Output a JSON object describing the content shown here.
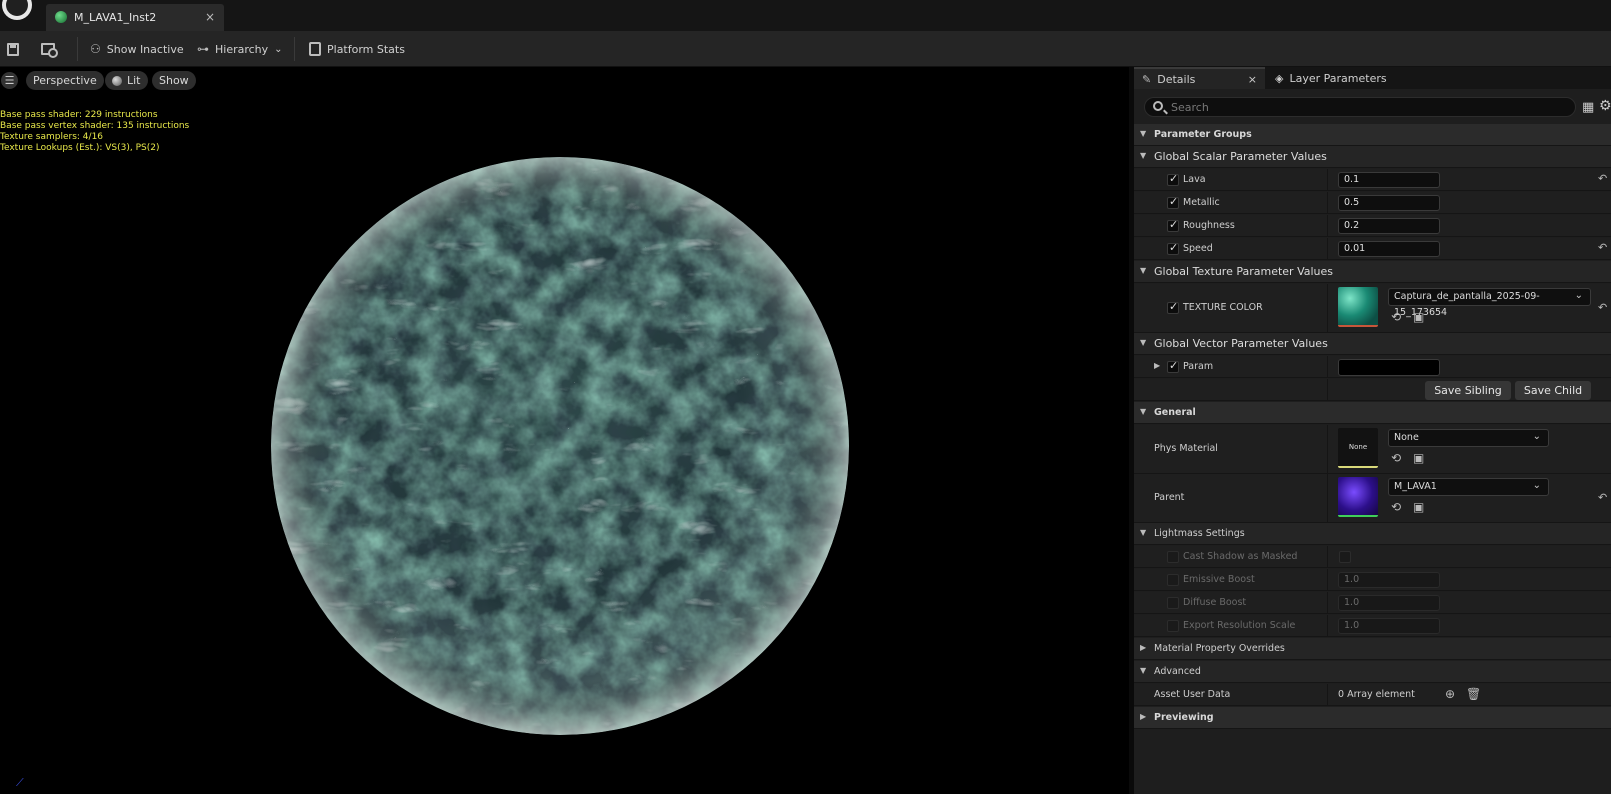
{
  "tab": {
    "title": "M_LAVA1_Inst2",
    "close": "×"
  },
  "toolbar": {
    "show_inactive": "Show Inactive",
    "hierarchy": "Hierarchy",
    "platform_stats": "Platform Stats"
  },
  "viewport": {
    "menu": "☰",
    "perspective": "Perspective",
    "lit": "Lit",
    "show": "Show",
    "stats": [
      "Base pass shader: 229 instructions",
      "Base pass vertex shader: 135 instructions",
      "Texture samplers: 4/16",
      "Texture Lookups (Est.): VS(3), PS(2)"
    ]
  },
  "panel": {
    "tabs": {
      "details": "Details",
      "layer_parameters": "Layer Parameters",
      "close": "×"
    },
    "search_placeholder": "Search",
    "parameter_groups": "Parameter Groups",
    "scalar": {
      "title": "Global Scalar Parameter Values",
      "items": [
        {
          "name": "Lava",
          "value": "0.1"
        },
        {
          "name": "Metallic",
          "value": "0.5"
        },
        {
          "name": "Roughness",
          "value": "0.2"
        },
        {
          "name": "Speed",
          "value": "0.01"
        }
      ]
    },
    "texture": {
      "title": "Global Texture Parameter Values",
      "name": "TEXTURE COLOR",
      "asset": "Captura_de_pantalla_2025-09-15_173654"
    },
    "vector": {
      "title": "Global Vector Parameter Values",
      "name": "Param"
    },
    "buttons": {
      "save_sibling": "Save Sibling",
      "save_child": "Save Child"
    },
    "general": {
      "title": "General",
      "phys_material_label": "Phys Material",
      "phys_material_thumb": "None",
      "phys_material_value": "None",
      "parent_label": "Parent",
      "parent_value": "M_LAVA1"
    },
    "lightmass": {
      "title": "Lightmass Settings",
      "items": [
        {
          "name": "Cast Shadow as Masked",
          "value": ""
        },
        {
          "name": "Emissive Boost",
          "value": "1.0"
        },
        {
          "name": "Diffuse Boost",
          "value": "1.0"
        },
        {
          "name": "Export Resolution Scale",
          "value": "1.0"
        }
      ]
    },
    "material_overrides": "Material Property Overrides",
    "advanced": {
      "title": "Advanced",
      "asset_user_data_label": "Asset User Data",
      "asset_user_data_value": "0 Array element"
    },
    "previewing": "Previewing"
  },
  "colors": {
    "accent_checked": "#dfdfdf",
    "stats_text": "#e8e84a",
    "texture_underline": "#c8563a",
    "phys_underline": "#d9d97a",
    "parent_underline": "#3fcf5a"
  }
}
